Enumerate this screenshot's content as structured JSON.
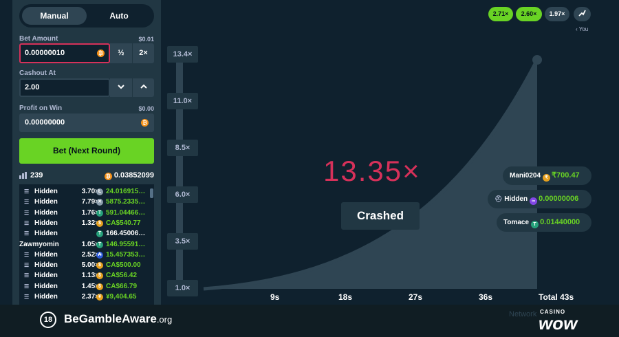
{
  "tabs": {
    "manual": "Manual",
    "auto": "Auto"
  },
  "bet": {
    "label": "Bet Amount",
    "usd": "$0.01",
    "value": "0.00000010",
    "half": "½",
    "double": "2×"
  },
  "cashout": {
    "label": "Cashout At",
    "value": "2.00"
  },
  "profit": {
    "label": "Profit on Win",
    "usd": "$0.00",
    "value": "0.00000000"
  },
  "bet_button": "Bet (Next Round)",
  "stats": {
    "players": "239",
    "total": "0.03852099"
  },
  "rows": [
    {
      "name": "Hidden",
      "mult": "3.70×",
      "amount": "24.016915…",
      "coin": "ltc",
      "color": "#8a9cab"
    },
    {
      "name": "Hidden",
      "mult": "7.79×",
      "amount": "5875.2335…",
      "coin": "xrp",
      "color": "#8a9cab"
    },
    {
      "name": "Hidden",
      "mult": "1.76×",
      "amount": "591.04466…",
      "coin": "usdt",
      "color": "#26a17b"
    },
    {
      "name": "Hidden",
      "mult": "1.32×",
      "amount": "CA$540.77",
      "coin": "cad",
      "color": "#e6a01e"
    },
    {
      "name": "Hidden",
      "mult": "-",
      "amount": "166.45006…",
      "coin": "usdt",
      "color": "#26a17b"
    },
    {
      "name": "Zawmyomin",
      "mult": "1.05×",
      "amount": "146.95591…",
      "coin": "usdt",
      "color": "#26a17b"
    },
    {
      "name": "Hidden",
      "mult": "2.52×",
      "amount": "15.457353…",
      "coin": "ada",
      "color": "#2a5ada"
    },
    {
      "name": "Hidden",
      "mult": "5.00×",
      "amount": "CA$500.00",
      "coin": "cad",
      "color": "#e6a01e"
    },
    {
      "name": "Hidden",
      "mult": "1.13×",
      "amount": "CA$56.42",
      "coin": "cad",
      "color": "#e6a01e"
    },
    {
      "name": "Hidden",
      "mult": "1.45×",
      "amount": "CA$66.79",
      "coin": "cad",
      "color": "#e6a01e"
    },
    {
      "name": "Hidden",
      "mult": "2.37×",
      "amount": "¥9,404.65",
      "coin": "jpy",
      "color": "#e6a01e"
    }
  ],
  "history": {
    "h1": "2.71×",
    "h2": "2.60×",
    "h3": "1.97×",
    "you": "‹ You"
  },
  "y_ticks": [
    "13.4×",
    "11.0×",
    "8.5×",
    "6.0×",
    "3.5×",
    "1.0×"
  ],
  "x_ticks": [
    "9s",
    "18s",
    "27s",
    "36s",
    "Total 43s"
  ],
  "result": {
    "multiplier": "13.35×",
    "status": "Crashed"
  },
  "winners": [
    {
      "name": "Mani0204",
      "amount": "₹700.47"
    },
    {
      "name": "Hidden",
      "amount": "0.00000006"
    },
    {
      "name": "Tomace",
      "amount": "0.01440000"
    }
  ],
  "banner": {
    "badge": "18",
    "brand": "BeGambleAware",
    "tld": ".org",
    "casino": "CASINO",
    "wow": "wow",
    "network": "Network"
  },
  "colors": {
    "accent_green": "#69d324",
    "crash_red": "#d6315a",
    "panel": "#213743",
    "bg": "#0f212e"
  }
}
